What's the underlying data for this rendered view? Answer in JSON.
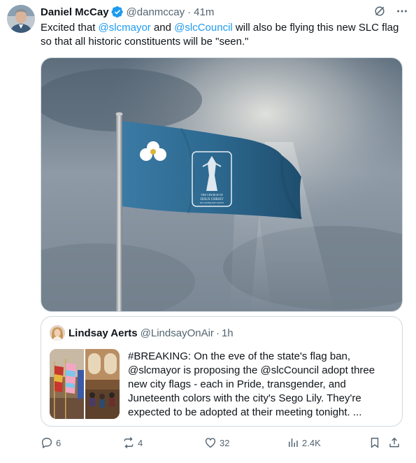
{
  "author": {
    "name": "Daniel McCay",
    "handle": "@danmccay",
    "separator": "·",
    "time": "41m"
  },
  "tweet": {
    "text_1": "Excited that ",
    "mention_1": "@slcmayor",
    "text_2": " and ",
    "mention_2": "@slcCouncil",
    "text_3": " will also be flying this new SLC flag so that all historic constituents will be \"seen.\""
  },
  "media": {
    "flag_seal_line_1": "THE CHURCH OF",
    "flag_seal_line_2": "JESUS CHRIST",
    "flag_seal_line_3": "OF LATTER-DAY SAINTS"
  },
  "quote": {
    "name": "Lindsay Aerts",
    "handle": "@LindsayOnAir",
    "separator": "·",
    "time": "1h",
    "text": "#BREAKING: On the eve of the state's flag ban, @slcmayor is proposing the @slcCouncil adopt three new city flags - each in Pride, transgender, and Juneteenth colors with the city's Sego Lily. They're expected to be adopted at their meeting tonight. ..."
  },
  "actions": {
    "replies": "6",
    "reposts": "4",
    "likes": "32",
    "views": "2.4K"
  },
  "colors": {
    "accent": "#1d9bf0",
    "text": "#0f1419",
    "secondary": "#536471",
    "border": "#cfd9de",
    "flag_blue": "#2f6b93"
  }
}
